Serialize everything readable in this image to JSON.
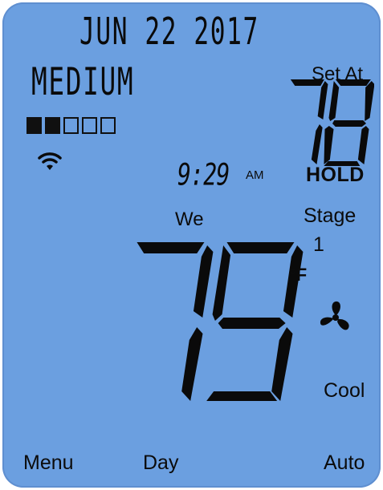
{
  "display": {
    "date": "JUN 22 2017",
    "fan_speed_label": "MEDIUM",
    "fan_speed_level": {
      "filled": 2,
      "total": 5
    },
    "set_at_label": "Set At",
    "set_temp": "78",
    "hold_label": "HOLD",
    "time": "9:29",
    "ampm": "AM",
    "weekday": "We",
    "stage_label": "Stage",
    "stage_number": "1",
    "room_temp": "79",
    "unit": "°F",
    "system_mode": "Cool"
  },
  "softkeys": {
    "left": "Menu",
    "center": "Day",
    "right": "Auto"
  },
  "icons": {
    "wifi": "wifi-icon",
    "fan": "fan-icon"
  },
  "colors": {
    "lcd_background": "#6b9fe0",
    "segment": "#0a0a0a"
  }
}
